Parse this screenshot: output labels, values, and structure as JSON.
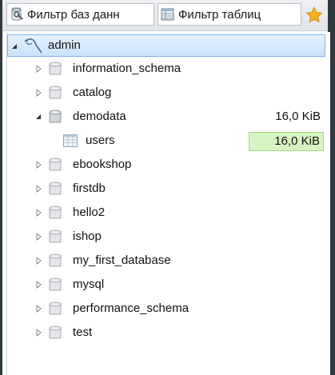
{
  "filters": {
    "databases_placeholder": "Фильтр баз данн",
    "tables_placeholder": "Фильтр таблиц"
  },
  "tree": {
    "root": {
      "label": "admin",
      "expanded": true
    },
    "databases": [
      {
        "name": "information_schema",
        "expanded": false
      },
      {
        "name": "catalog",
        "expanded": false
      },
      {
        "name": "demodata",
        "expanded": true,
        "size": "16,0 KiB",
        "tables": [
          {
            "name": "users",
            "size": "16,0 KiB",
            "highlight_color": "#d6f4c1"
          }
        ]
      },
      {
        "name": "ebookshop",
        "expanded": false
      },
      {
        "name": "firstdb",
        "expanded": false
      },
      {
        "name": "hello2",
        "expanded": false
      },
      {
        "name": "ishop",
        "expanded": false
      },
      {
        "name": "my_first_database",
        "expanded": false
      },
      {
        "name": "mysql",
        "expanded": false
      },
      {
        "name": "performance_schema",
        "expanded": false
      },
      {
        "name": "test",
        "expanded": false
      }
    ]
  },
  "colors": {
    "selection": "#c9e2fa",
    "size_highlight": "#d6f4c1",
    "window_background": "#2e3a3f"
  }
}
